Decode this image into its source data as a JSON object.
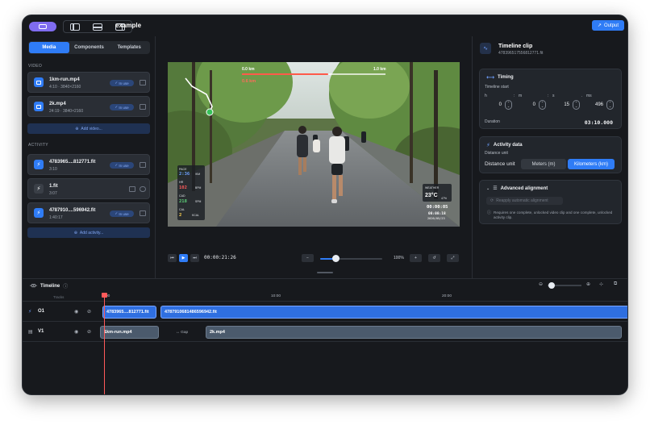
{
  "header": {
    "project_title": "example",
    "output_label": "Output"
  },
  "left_panel": {
    "tabs": [
      "Media",
      "Components",
      "Templates"
    ],
    "video_section": "VIDEO",
    "video_items": [
      {
        "name": "1km-run.mp4",
        "sub": "4:10 · 3840×2160",
        "badge": "In use"
      },
      {
        "name": "2k.mp4",
        "sub": "24:19 · 3840×2160",
        "badge": "In use"
      }
    ],
    "add_video": "Add video...",
    "activity_section": "ACTIVITY",
    "activity_items": [
      {
        "name": "4783965....812771.fit",
        "sub": "3:10",
        "badge": "In use"
      },
      {
        "name": "1.fit",
        "sub": "3:07",
        "badge": ""
      },
      {
        "name": "4787910....596942.fit",
        "sub": "1:40:17",
        "badge": "In use"
      }
    ],
    "add_activity": "Add activity..."
  },
  "overlay": {
    "dist_start": "0.0 km",
    "dist_end": "1.0 km",
    "dist_current": "0.6 km",
    "dist_progress": 0.6,
    "pace_label": "PACE",
    "pace_value": "2:36",
    "pace_unit": "/KM",
    "hr_label": "HR",
    "hr_value": "102",
    "hr_unit": "BPM",
    "cad_label": "CAD",
    "cad_value": "218",
    "cad_unit": "SPM",
    "cal_label": "CAL",
    "cal_value": "2",
    "cal_unit": "KCAL",
    "weather_label": "WEATHER",
    "weather_temp": "23°C",
    "weather_humidity": "47%",
    "elapsed": "00:00:05",
    "clock": "08:08:18",
    "date": "2026/05/23"
  },
  "player": {
    "timecode": "00:00:21:26",
    "zoom_value": "100%",
    "zoom_level": 0.25
  },
  "right_panel": {
    "clip_title": "Timeline clip",
    "clip_file": "4783965175568127​71.fit",
    "timing_title": "Timing",
    "timeline_start": "Timeline start",
    "fields": [
      {
        "label": "h",
        "value": "0"
      },
      {
        "label": "m",
        "value": "0"
      },
      {
        "label": "s",
        "value": "15"
      },
      {
        "label": "ms",
        "value": "496"
      }
    ],
    "duration_label": "Duration",
    "duration_value": "03:10.000",
    "activity_title": "Activity data",
    "distance_unit_label": "Distance unit",
    "distance_unit_row": "Distance unit",
    "unit_options": [
      "Meters (m)",
      "Kilometers (km)"
    ],
    "selected_unit": "Kilometers (km)",
    "advanced_title": "Advanced alignment",
    "reapply_label": "Reapply automatic alignment",
    "note": "Requires one complete, unlocked video clip and one complete, unlocked activity clip."
  },
  "timeline": {
    "title": "Timeline",
    "tracks_label": "Tracks",
    "ticks": [
      "0:00",
      "10:00",
      "20:00"
    ],
    "tracks": [
      {
        "name": "O1",
        "clips": [
          "4783965....812771.fit",
          "4787910681486596942.fit"
        ]
      },
      {
        "name": "V1",
        "clips": [
          "1km-run.mp4",
          "2k.mp4"
        ],
        "gap": "↔ Gap"
      }
    ]
  },
  "colors": {
    "accent": "#2f7cf6",
    "background": "#17191d",
    "playhead": "#ff5a5a"
  }
}
